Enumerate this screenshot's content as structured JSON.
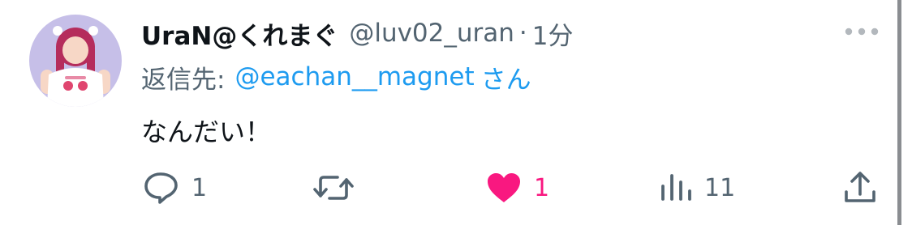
{
  "tweet": {
    "display_name": "UraN@くれまぐ",
    "handle": "@luv02_uran",
    "separator": "·",
    "time": "1分",
    "reply_prefix": "返信先:",
    "reply_user": "@eachan__magnet",
    "reply_suffix": "さん",
    "text": "なんだい！"
  },
  "actions": {
    "reply": {
      "icon": "comment-icon",
      "count": "1"
    },
    "retweet": {
      "icon": "retweet-icon",
      "count": ""
    },
    "like": {
      "icon": "heart-icon",
      "count": "1",
      "active": true,
      "color": "#f91880"
    },
    "views": {
      "icon": "bar-chart-icon",
      "count": "11"
    },
    "share": {
      "icon": "share-icon"
    }
  },
  "colors": {
    "text": "#0f1419",
    "muted": "#536471",
    "link": "#1d9bf0",
    "like": "#f91880"
  }
}
